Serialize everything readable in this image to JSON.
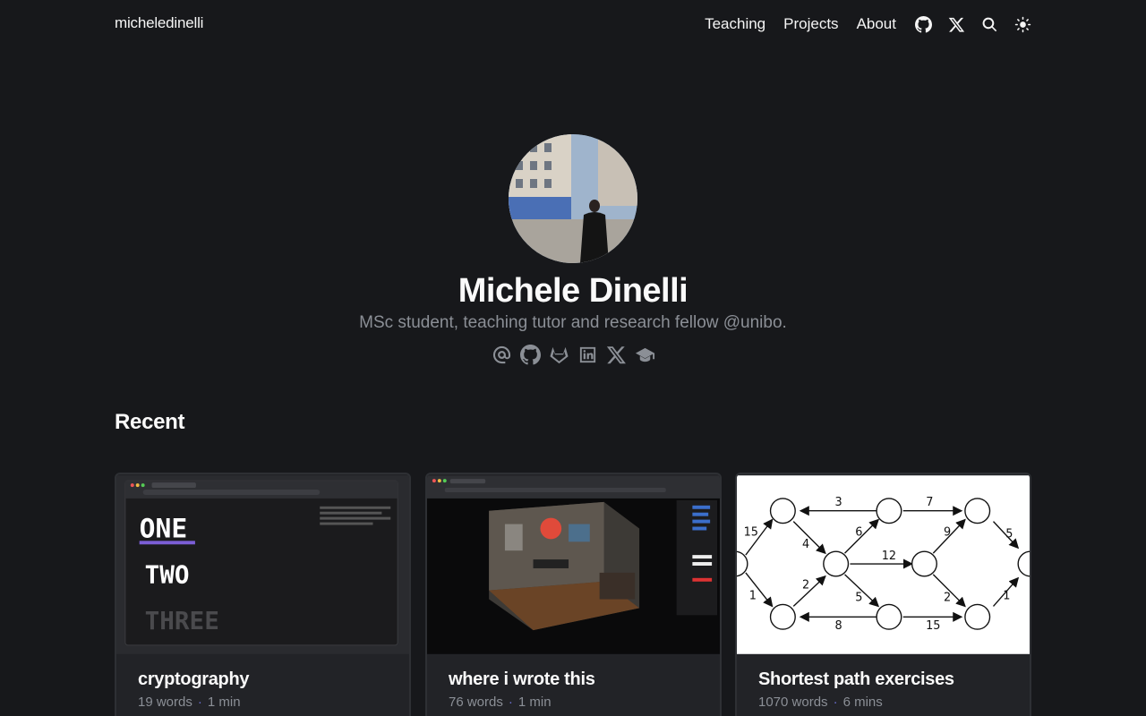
{
  "site": {
    "brand": "micheledinelli",
    "nav": [
      {
        "label": "Teaching"
      },
      {
        "label": "Projects"
      },
      {
        "label": "About"
      }
    ],
    "nav_icons": [
      "github-icon",
      "x-icon",
      "search-icon",
      "theme-toggle-icon"
    ]
  },
  "profile": {
    "name": "Michele Dinelli",
    "tagline": "MSc student, teaching tutor and research fellow @unibo.",
    "social_icons": [
      "email-icon",
      "github-icon",
      "gitlab-icon",
      "linkedin-icon",
      "x-icon",
      "scholar-icon"
    ]
  },
  "recent": {
    "title": "Recent",
    "posts": [
      {
        "title": "cryptography",
        "words": "19 words",
        "time": "1 min",
        "thumb": {
          "lines": [
            "ONE",
            "TWO",
            "THREE"
          ]
        }
      },
      {
        "title": "where i wrote this",
        "words": "76 words",
        "time": "1 min"
      },
      {
        "title": "Shortest path exercises",
        "words": "1070 words",
        "time": "6 mins",
        "thumb": {
          "edge_labels": [
            "15",
            "3",
            "7",
            "4",
            "6",
            "12",
            "9",
            "5",
            "1",
            "2",
            "5",
            "2",
            "1",
            "8",
            "15"
          ]
        }
      }
    ]
  },
  "colors": {
    "background": "#17181b",
    "card": "#222327",
    "muted": "#8b8f96",
    "accent": "#6b6fd0"
  }
}
